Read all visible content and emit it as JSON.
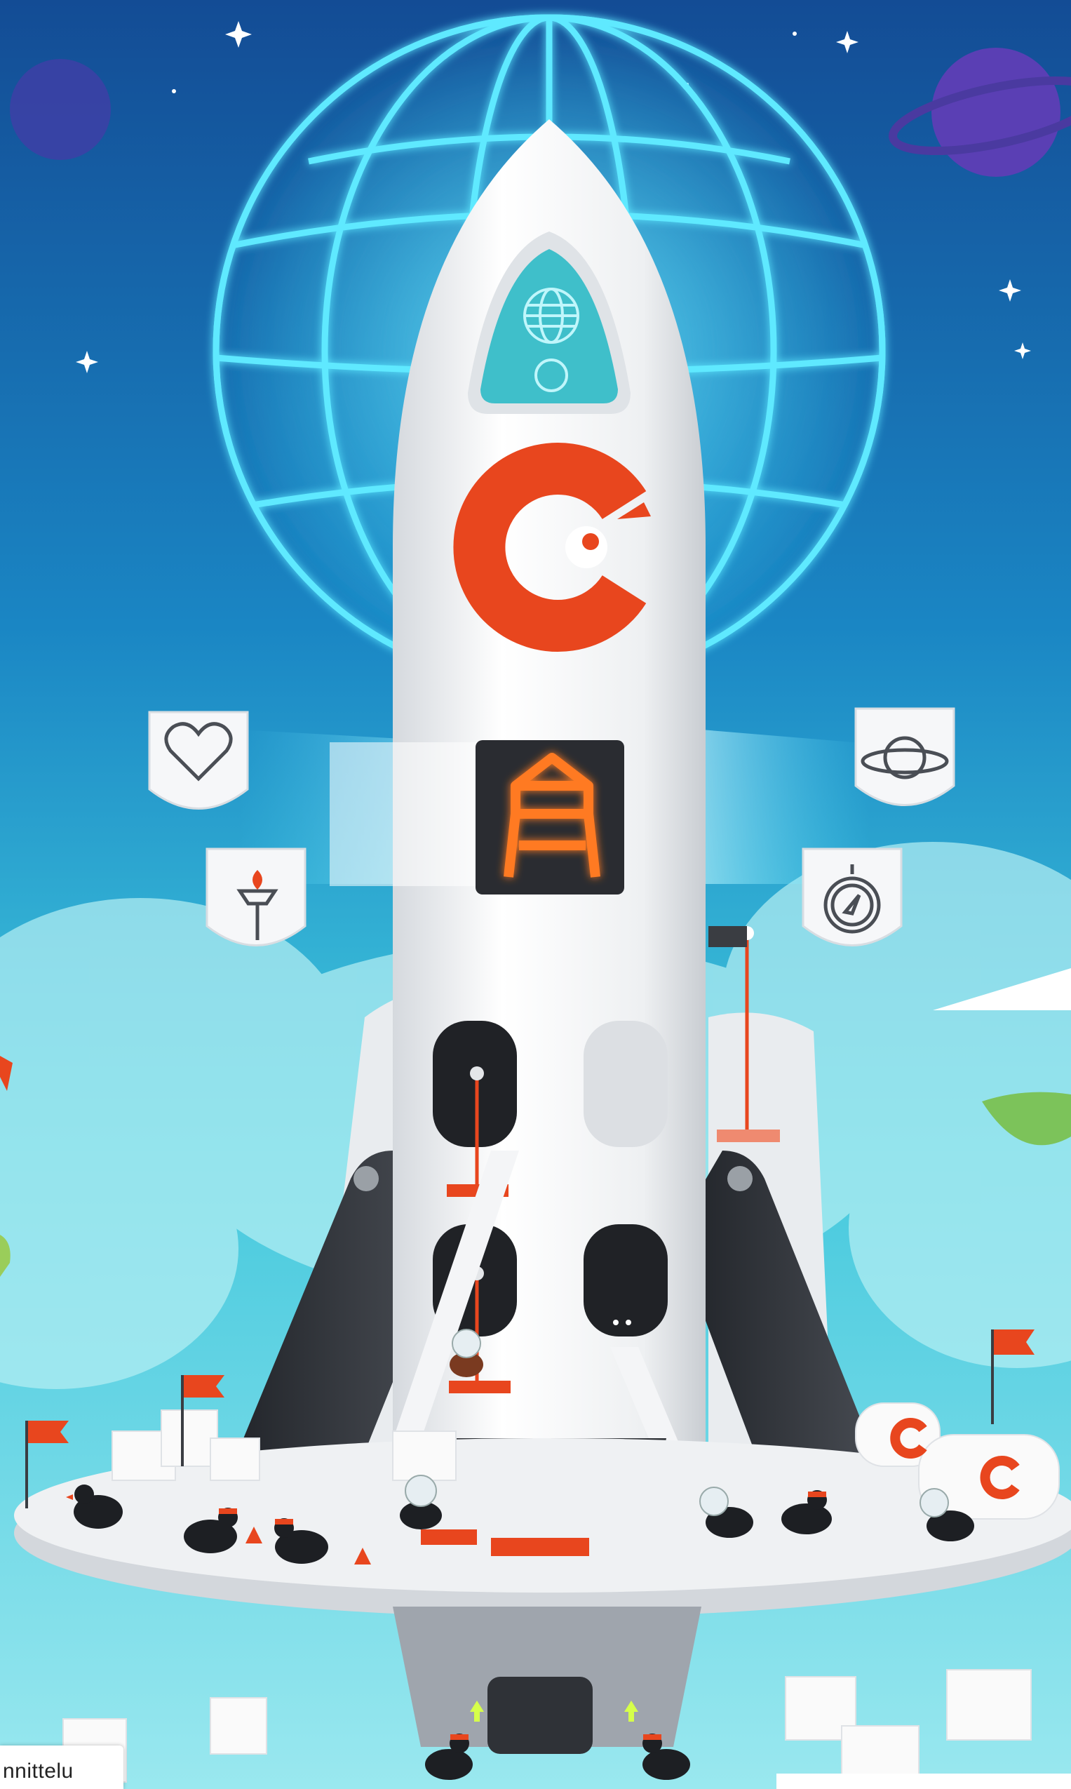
{
  "caption": {
    "text": "nnittelu"
  },
  "logo": {
    "letter": "C",
    "color": "#e8461e"
  },
  "palette": {
    "sky_top": "#134c95",
    "sky_mid": "#1fa6cf",
    "sky_bottom": "#8fe4ec",
    "glow": "#39e0ff",
    "rocket_body": "#f1f2f4",
    "accent_orange": "#e8461e",
    "dark_fin": "#2a2d33"
  },
  "icons": [
    "globe-icon",
    "heart-icon",
    "planet-icon",
    "torch-icon",
    "compass-icon",
    "ladder-icon",
    "flag-icon",
    "penguin-icon"
  ]
}
